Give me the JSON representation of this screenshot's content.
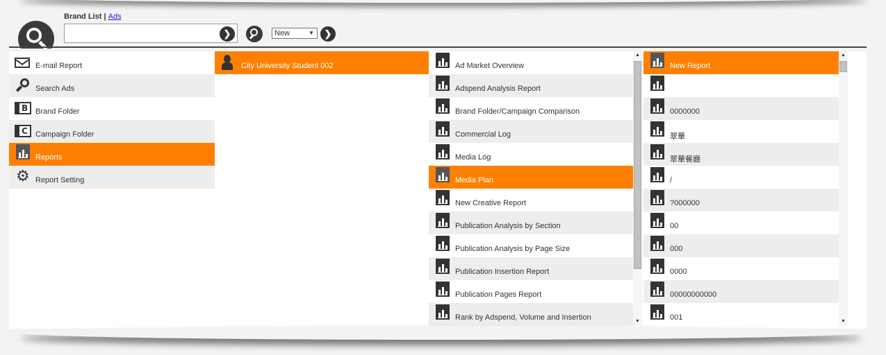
{
  "header": {
    "brand_list_label": "Brand List",
    "separator": "|",
    "ads_link": "Ads",
    "search_value": "",
    "select_value": "New"
  },
  "menu": [
    {
      "label": "E-mail Report",
      "icon": "envelope-icon"
    },
    {
      "label": "Search Ads",
      "icon": "magnifier-icon"
    },
    {
      "label": "Brand Folder",
      "icon": "brand-folder-icon"
    },
    {
      "label": "Campaign Folder",
      "icon": "campaign-folder-icon"
    },
    {
      "label": "Reports",
      "icon": "report-icon"
    },
    {
      "label": "Report Setting",
      "icon": "gear-icon"
    }
  ],
  "users": [
    {
      "label": "City University Student 002"
    }
  ],
  "report_types": [
    {
      "label": "Ad Market Overview"
    },
    {
      "label": "Adspend Analysis Report"
    },
    {
      "label": "Brand Folder/Campaign Comparison"
    },
    {
      "label": "Commercial Log"
    },
    {
      "label": "Media Log"
    },
    {
      "label": "Media Plan"
    },
    {
      "label": "New Creative Report"
    },
    {
      "label": "Publication Analysis by Section"
    },
    {
      "label": "Publication Analysis by Page Size"
    },
    {
      "label": "Publication Insertion Report"
    },
    {
      "label": "Publication Pages Report"
    },
    {
      "label": "Rank by Adspend, Volume and Insertion"
    }
  ],
  "saved_reports": [
    {
      "label": "New Report"
    },
    {
      "label": ""
    },
    {
      "label": "0000000"
    },
    {
      "label": "翠華"
    },
    {
      "label": "翠華餐廳"
    },
    {
      "label": "/"
    },
    {
      "label": "?000000"
    },
    {
      "label": "00"
    },
    {
      "label": "000"
    },
    {
      "label": "0000"
    },
    {
      "label": "00000000000"
    },
    {
      "label": "001"
    }
  ],
  "colors": {
    "selected": "#ff8000",
    "alt_row": "#ededed"
  }
}
